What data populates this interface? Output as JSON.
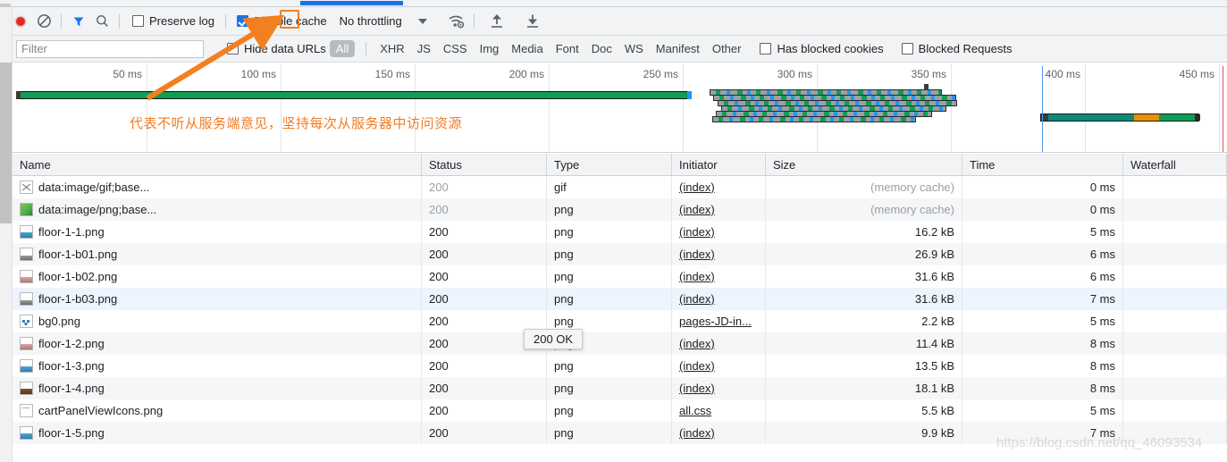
{
  "toolbar": {
    "record_icon": "record-circle-icon",
    "clear_icon": "clear-prohibited-icon",
    "filter_icon": "funnel-filter-icon",
    "search_icon": "search-magnifier-icon",
    "preserve_log_label": "Preserve log",
    "preserve_log_checked": false,
    "disable_cache_label": "Disable cache",
    "disable_cache_checked": true,
    "throttling_label": "No throttling",
    "throttle_caret_icon": "chevron-down-icon",
    "network_conditions_icon": "wifi-settings-icon",
    "import_icon": "upload-arrow-icon",
    "export_icon": "download-arrow-icon"
  },
  "filter_bar": {
    "filter_placeholder": "Filter",
    "filter_value": "",
    "hide_data_urls_label": "Hide data URLs",
    "hide_data_urls_checked": false,
    "types": [
      "All",
      "XHR",
      "JS",
      "CSS",
      "Img",
      "Media",
      "Font",
      "Doc",
      "WS",
      "Manifest",
      "Other"
    ],
    "active_type": "All",
    "has_blocked_cookies_label": "Has blocked cookies",
    "has_blocked_cookies_checked": false,
    "blocked_requests_label": "Blocked Requests",
    "blocked_requests_checked": false
  },
  "overview": {
    "ticks": [
      "50 ms",
      "100 ms",
      "150 ms",
      "200 ms",
      "250 ms",
      "300 ms",
      "350 ms",
      "400 ms",
      "450 ms"
    ],
    "annotation_text": "代表不听从服务端意见，坚持每次从服务器中访问资源",
    "annotation_color": "#f07c23",
    "dom_content_loaded_color": "#1a73e8",
    "load_event_color": "#e05252"
  },
  "table": {
    "columns": [
      "Name",
      "Status",
      "Type",
      "Initiator",
      "Size",
      "Time",
      "Waterfall"
    ],
    "rows": [
      {
        "name": "data:image/gif;base...",
        "icon": "file-cross-icon",
        "status": "200",
        "status_muted": true,
        "type": "gif",
        "initiator": "(index)",
        "size": "(memory cache)",
        "size_muted": true,
        "time": "0 ms",
        "selected": false
      },
      {
        "name": "data:image/png;base...",
        "icon": "image-green-icon",
        "status": "200",
        "status_muted": true,
        "type": "png",
        "initiator": "(index)",
        "size": "(memory cache)",
        "size_muted": true,
        "time": "0 ms",
        "selected": false
      },
      {
        "name": "floor-1-1.png",
        "icon": "image-blue-icon",
        "status": "200",
        "status_muted": false,
        "type": "png",
        "initiator": "(index)",
        "size": "16.2 kB",
        "size_muted": false,
        "time": "5 ms",
        "selected": false
      },
      {
        "name": "floor-1-b01.png",
        "icon": "image-grey-icon",
        "status": "200",
        "status_muted": false,
        "type": "png",
        "initiator": "(index)",
        "size": "26.9 kB",
        "size_muted": false,
        "time": "6 ms",
        "selected": false
      },
      {
        "name": "floor-1-b02.png",
        "icon": "image-pink-icon",
        "status": "200",
        "status_muted": false,
        "type": "png",
        "initiator": "(index)",
        "size": "31.6 kB",
        "size_muted": false,
        "time": "6 ms",
        "selected": false
      },
      {
        "name": "floor-1-b03.png",
        "icon": "image-grey-icon",
        "status": "200",
        "status_muted": false,
        "type": "png",
        "initiator": "(index)",
        "size": "31.6 kB",
        "size_muted": false,
        "time": "7 ms",
        "selected": true
      },
      {
        "name": "bg0.png",
        "icon": "image-dots-icon",
        "status": "200",
        "status_muted": false,
        "type": "png",
        "initiator": "pages-JD-in...",
        "size": "2.2 kB",
        "size_muted": false,
        "time": "5 ms",
        "selected": false
      },
      {
        "name": "floor-1-2.png",
        "icon": "image-pink-icon",
        "status": "200",
        "status_muted": false,
        "type": "png",
        "initiator": "(index)",
        "size": "11.4 kB",
        "size_muted": false,
        "time": "8 ms",
        "selected": false
      },
      {
        "name": "floor-1-3.png",
        "icon": "image-blue-icon",
        "status": "200",
        "status_muted": false,
        "type": "png",
        "initiator": "(index)",
        "size": "13.5 kB",
        "size_muted": false,
        "time": "8 ms",
        "selected": false
      },
      {
        "name": "floor-1-4.png",
        "icon": "image-brown-icon",
        "status": "200",
        "status_muted": false,
        "type": "png",
        "initiator": "(index)",
        "size": "18.1 kB",
        "size_muted": false,
        "time": "8 ms",
        "selected": false
      },
      {
        "name": "cartPanelViewIcons.png",
        "icon": "image-blank-icon",
        "status": "200",
        "status_muted": false,
        "type": "png",
        "initiator": "all.css",
        "size": "5.5 kB",
        "size_muted": false,
        "time": "5 ms",
        "selected": false
      },
      {
        "name": "floor-1-5.png",
        "icon": "image-blue-icon",
        "status": "200",
        "status_muted": false,
        "type": "png",
        "initiator": "(index)",
        "size": "9.9 kB",
        "size_muted": false,
        "time": "7 ms",
        "selected": false
      }
    ]
  },
  "tooltip": {
    "text": "200 OK"
  },
  "watermark": {
    "text": "https://blog.csdn.net/qq_46093534"
  }
}
